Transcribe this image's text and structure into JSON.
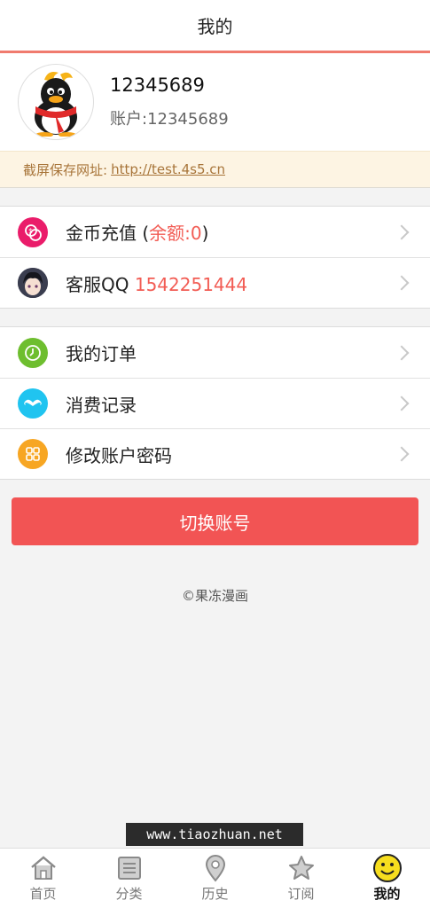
{
  "header": {
    "title": "我的"
  },
  "profile": {
    "username": "12345689",
    "account": "账户:12345689",
    "avatar_icon": "qq-penguin-icon"
  },
  "notice": {
    "label": "截屏保存网址:",
    "url": "http://test.4s5.cn"
  },
  "group1": {
    "recharge": {
      "label": "金币充值 (",
      "balance": "余额:0",
      "close": ")",
      "icon": "coin-icon",
      "color": "#ea1c6a"
    },
    "service": {
      "label": "客服QQ ",
      "qq": "1542251444",
      "icon": "anime-avatar-icon"
    }
  },
  "group2": {
    "orders": {
      "label": "我的订单",
      "icon": "clock-icon",
      "color": "#6ebe2f"
    },
    "records": {
      "label": "消费记录",
      "icon": "mustache-icon",
      "color": "#20c4f0"
    },
    "password": {
      "label": "修改账户密码",
      "icon": "grid-icon",
      "color": "#f7a623"
    }
  },
  "switch_button": "切换账号",
  "copyright": "©果冻漫画",
  "watermark": "www.tiaozhuan.net",
  "tabs": [
    {
      "label": "首页",
      "icon": "home-icon"
    },
    {
      "label": "分类",
      "icon": "book-icon"
    },
    {
      "label": "历史",
      "icon": "location-pin-icon"
    },
    {
      "label": "订阅",
      "icon": "star-icon"
    },
    {
      "label": "我的",
      "icon": "smiley-icon",
      "active": true
    }
  ]
}
